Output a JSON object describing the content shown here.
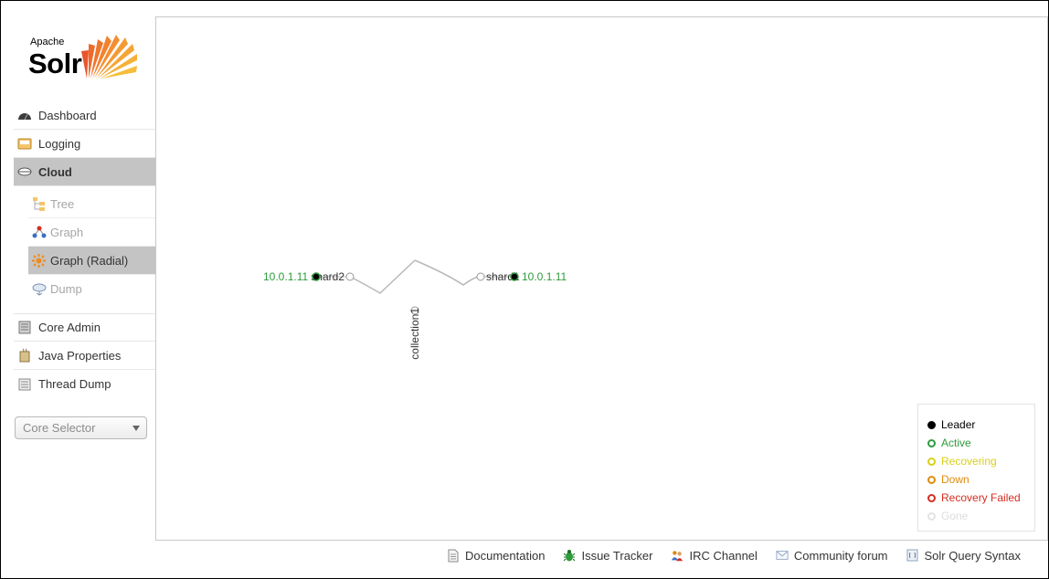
{
  "logo": {
    "apache": "Apache",
    "solr": "Solr"
  },
  "nav": {
    "dashboard": "Dashboard",
    "logging": "Logging",
    "cloud": "Cloud",
    "cloud_sub": {
      "tree": "Tree",
      "graph": "Graph",
      "graph_radial": "Graph (Radial)",
      "dump": "Dump"
    },
    "core_admin": "Core Admin",
    "java_properties": "Java Properties",
    "thread_dump": "Thread Dump"
  },
  "core_selector": {
    "placeholder": "Core Selector"
  },
  "graph": {
    "collection": "collection1",
    "shards": [
      {
        "name": "shard2",
        "replica": "10.0.1.11"
      },
      {
        "name": "shard1",
        "replica": "10.0.1.11"
      }
    ],
    "colors": {
      "active": "#2e9b3c",
      "leader_fill": "#000000",
      "edge": "#b8b8b8"
    }
  },
  "legend": [
    {
      "label": "Leader",
      "color": "#000000",
      "filled": true
    },
    {
      "label": "Active",
      "color": "#2e9b3c",
      "filled": false
    },
    {
      "label": "Recovering",
      "color": "#d9cf1a",
      "filled": false
    },
    {
      "label": "Down",
      "color": "#e08a0b",
      "filled": false
    },
    {
      "label": "Recovery Failed",
      "color": "#d62d20",
      "filled": false
    },
    {
      "label": "Gone",
      "color": "#dddddd",
      "filled": false
    }
  ],
  "footer": {
    "documentation": "Documentation",
    "issue_tracker": "Issue Tracker",
    "irc_channel": "IRC Channel",
    "community_forum": "Community forum",
    "solr_query_syntax": "Solr Query Syntax"
  }
}
